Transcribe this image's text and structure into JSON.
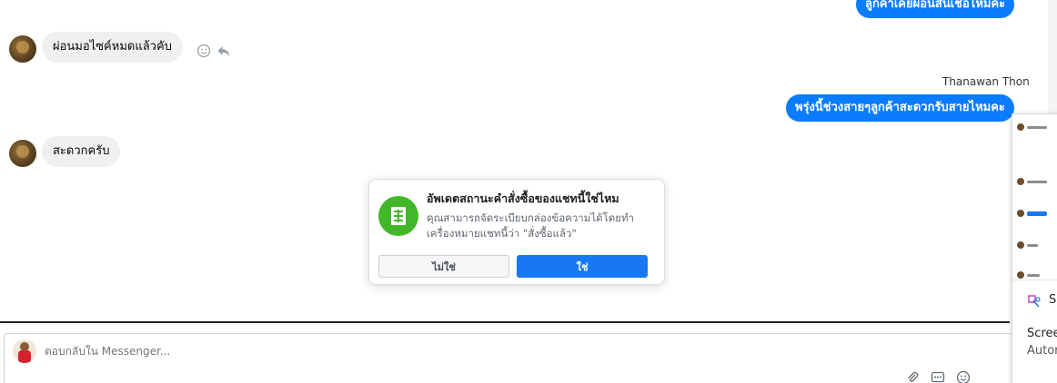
{
  "messages": {
    "top_outgoing": "ลูกค้าเคยผ่อนสินเชื่อไหมคะ",
    "incoming_1": "ผ่อนมอไซค์หมดแล้วคับ",
    "sender_name": "Thanawan Thon",
    "outgoing_2": "พรุ่งนี้ช่วงสายๆลูกค้าสะดวกรับสายไหมคะ",
    "incoming_2": "สะดวกครับ"
  },
  "icons": {
    "react": "smile-icon",
    "reply": "reply-icon",
    "order": "receipt-icon"
  },
  "dialog": {
    "title": "อัพเดตสถานะคำสั่งซื้อของแชทนี้ใช่ไหม",
    "body": "คุณสามารถจัดระเบียบกล่องข้อความได้โดยทำเครื่องหมายแชทนี้ว่า \"สั่งซื้อแล้ว\"",
    "cancel_label": "ไม่ใช่",
    "confirm_label": "ใช่"
  },
  "composer": {
    "placeholder": "ตอบกลับใน Messenger..."
  },
  "side_panel": {
    "snip_label": "Sn",
    "screen_label": "Scree",
    "auto_label": "Autor"
  },
  "colors": {
    "accent": "#0a7cff",
    "confirm": "#1877f2",
    "order_icon_bg": "#42b72a"
  }
}
